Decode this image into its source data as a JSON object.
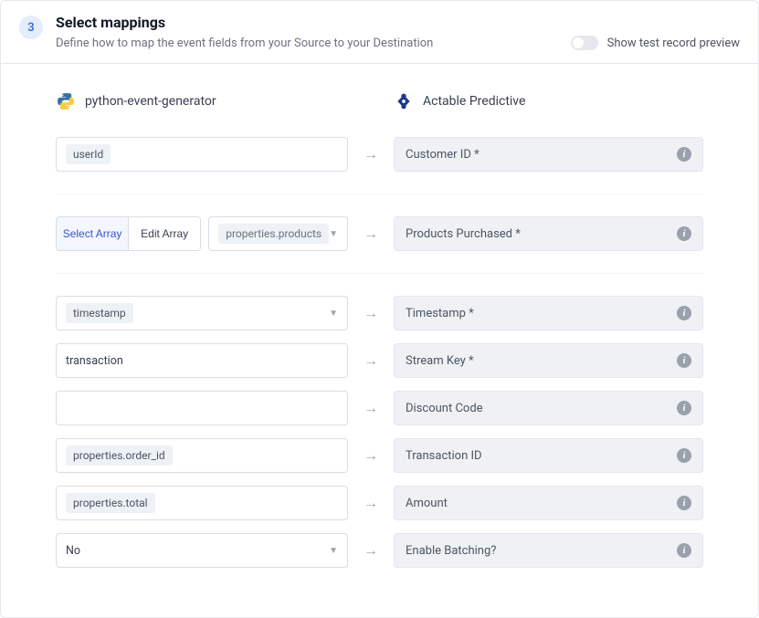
{
  "step": "3",
  "title": "Select mappings",
  "subtitle": "Define how to map the event fields from your Source to your Destination",
  "preview_label": "Show test record preview",
  "source_name": "python-event-generator",
  "destination_name": "Actable Predictive",
  "array_tabs": {
    "select": "Select Array",
    "edit": "Edit Array"
  },
  "array_value": "properties.products",
  "rows": {
    "r1": {
      "src": "userId",
      "dst": "Customer ID *"
    },
    "r2": {
      "dst": "Products Purchased *"
    },
    "r3": {
      "src": "timestamp",
      "dst": "Timestamp *"
    },
    "r4": {
      "src": "transaction",
      "dst": "Stream Key *"
    },
    "r5": {
      "src": "",
      "dst": "Discount Code"
    },
    "r6": {
      "src": "properties.order_id",
      "dst": "Transaction ID"
    },
    "r7": {
      "src": "properties.total",
      "dst": "Amount"
    },
    "r8": {
      "src": "No",
      "dst": "Enable Batching?"
    }
  }
}
